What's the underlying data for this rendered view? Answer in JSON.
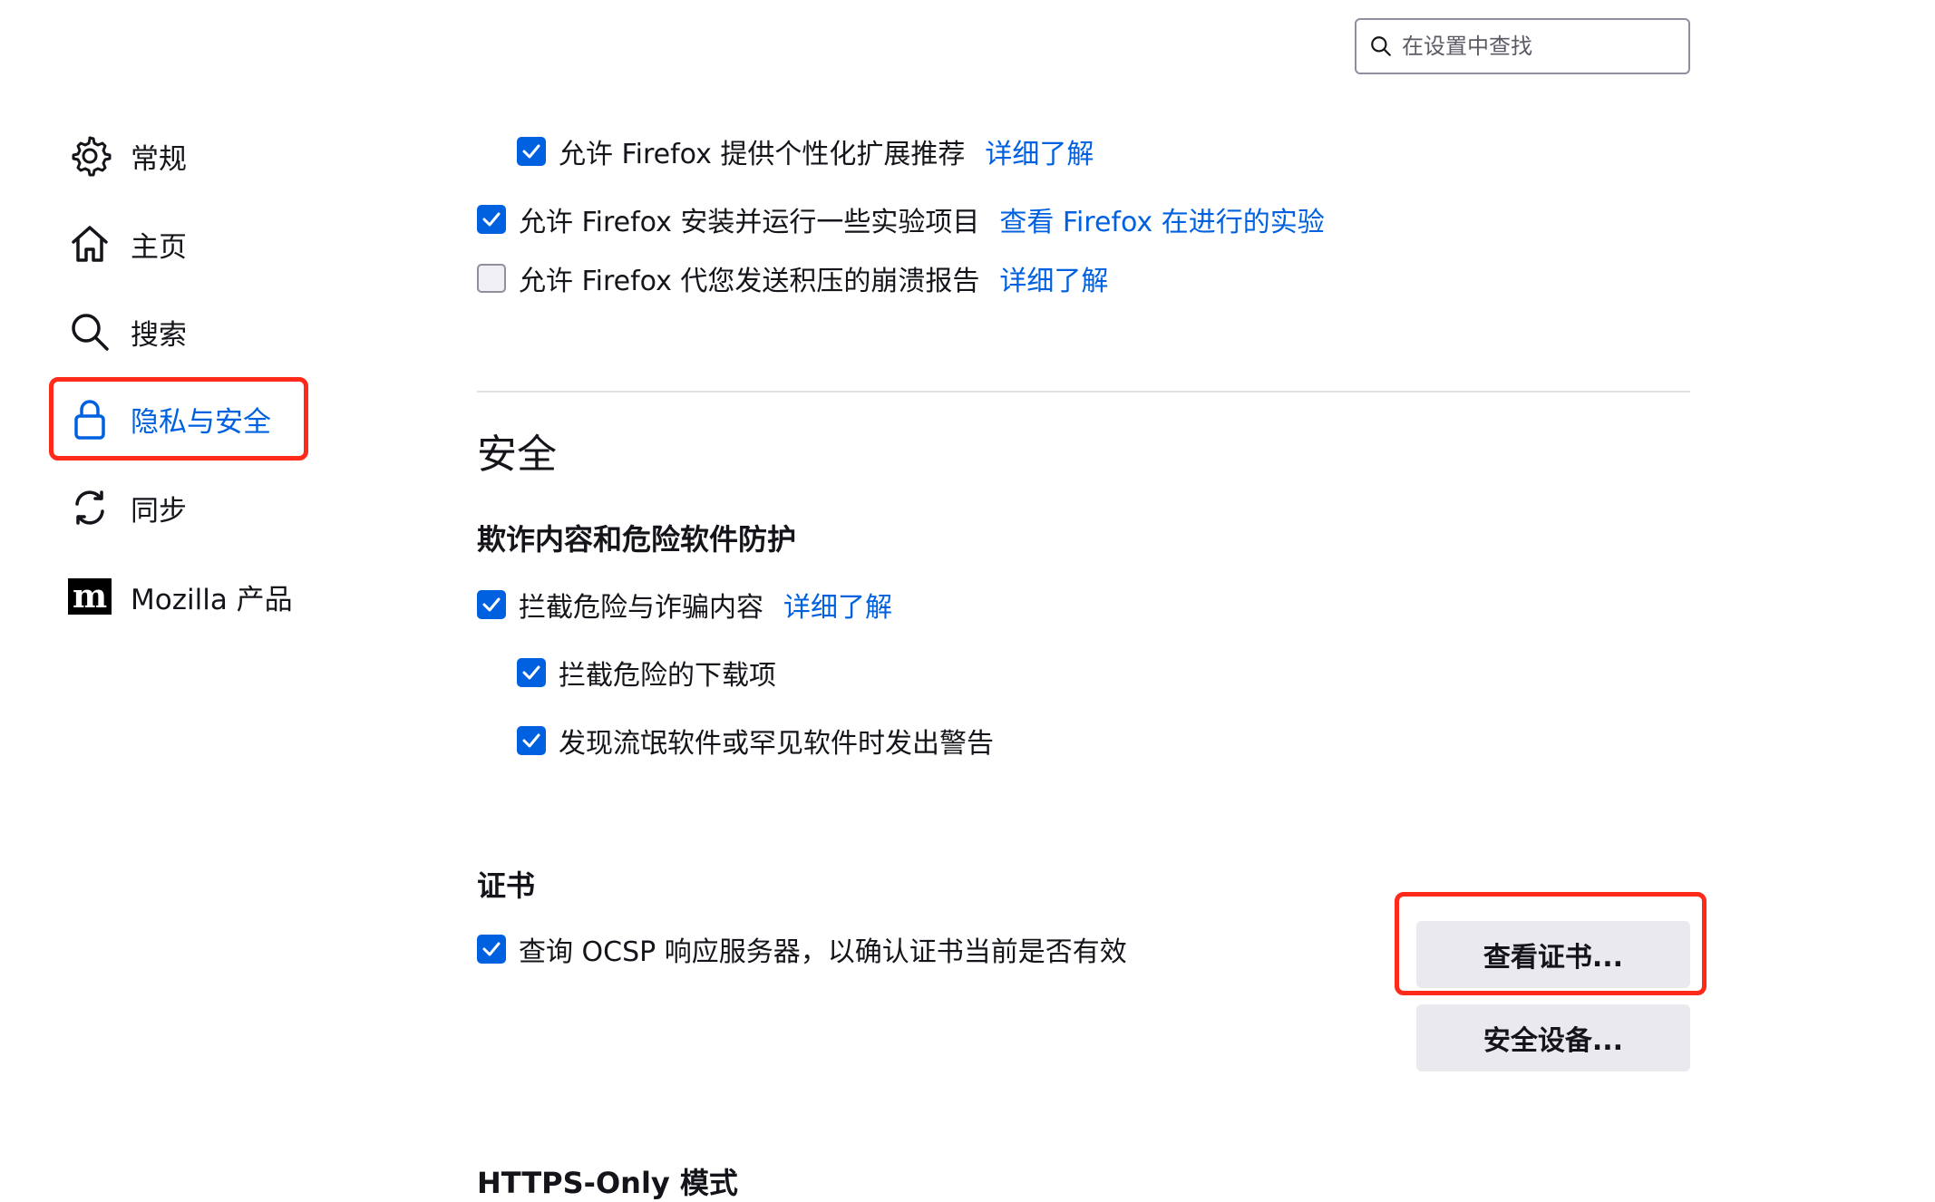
{
  "search": {
    "placeholder": "在设置中查找"
  },
  "sidebar": {
    "items": [
      {
        "label": "常规",
        "icon": "gear-icon"
      },
      {
        "label": "主页",
        "icon": "home-icon"
      },
      {
        "label": "搜索",
        "icon": "search-icon"
      },
      {
        "label": "隐私与安全",
        "icon": "lock-icon",
        "active": true
      },
      {
        "label": "同步",
        "icon": "sync-icon"
      },
      {
        "label": "Mozilla 产品",
        "icon": "mozilla-logo-icon"
      }
    ]
  },
  "data_collection": {
    "rows": [
      {
        "label": "允许 Firefox 提供个性化扩展推荐",
        "link": "详细了解",
        "checked": true
      },
      {
        "label": "允许 Firefox 安装并运行一些实验项目",
        "link": "查看 Firefox 在进行的实验",
        "checked": true
      },
      {
        "label": "允许 Firefox 代您发送积压的崩溃报告",
        "link": "详细了解",
        "checked": false
      }
    ]
  },
  "security": {
    "title": "安全",
    "deceptive": {
      "heading": "欺诈内容和危险软件防护",
      "block_dangerous": {
        "label": "拦截危险与诈骗内容",
        "link": "详细了解",
        "checked": true
      },
      "block_downloads": {
        "label": "拦截危险的下载项",
        "checked": true
      },
      "warn_unwanted": {
        "label": "发现流氓软件或罕见软件时发出警告",
        "checked": true
      }
    },
    "certificates": {
      "heading": "证书",
      "ocsp": {
        "label": "查询 OCSP 响应服务器，以确认证书当前是否有效",
        "checked": true
      },
      "view_button": "查看证书...",
      "devices_button": "安全设备..."
    },
    "https_only_heading": "HTTPS-Only 模式"
  },
  "colors": {
    "accent": "#0061e0",
    "highlight": "#ff2a1a"
  }
}
